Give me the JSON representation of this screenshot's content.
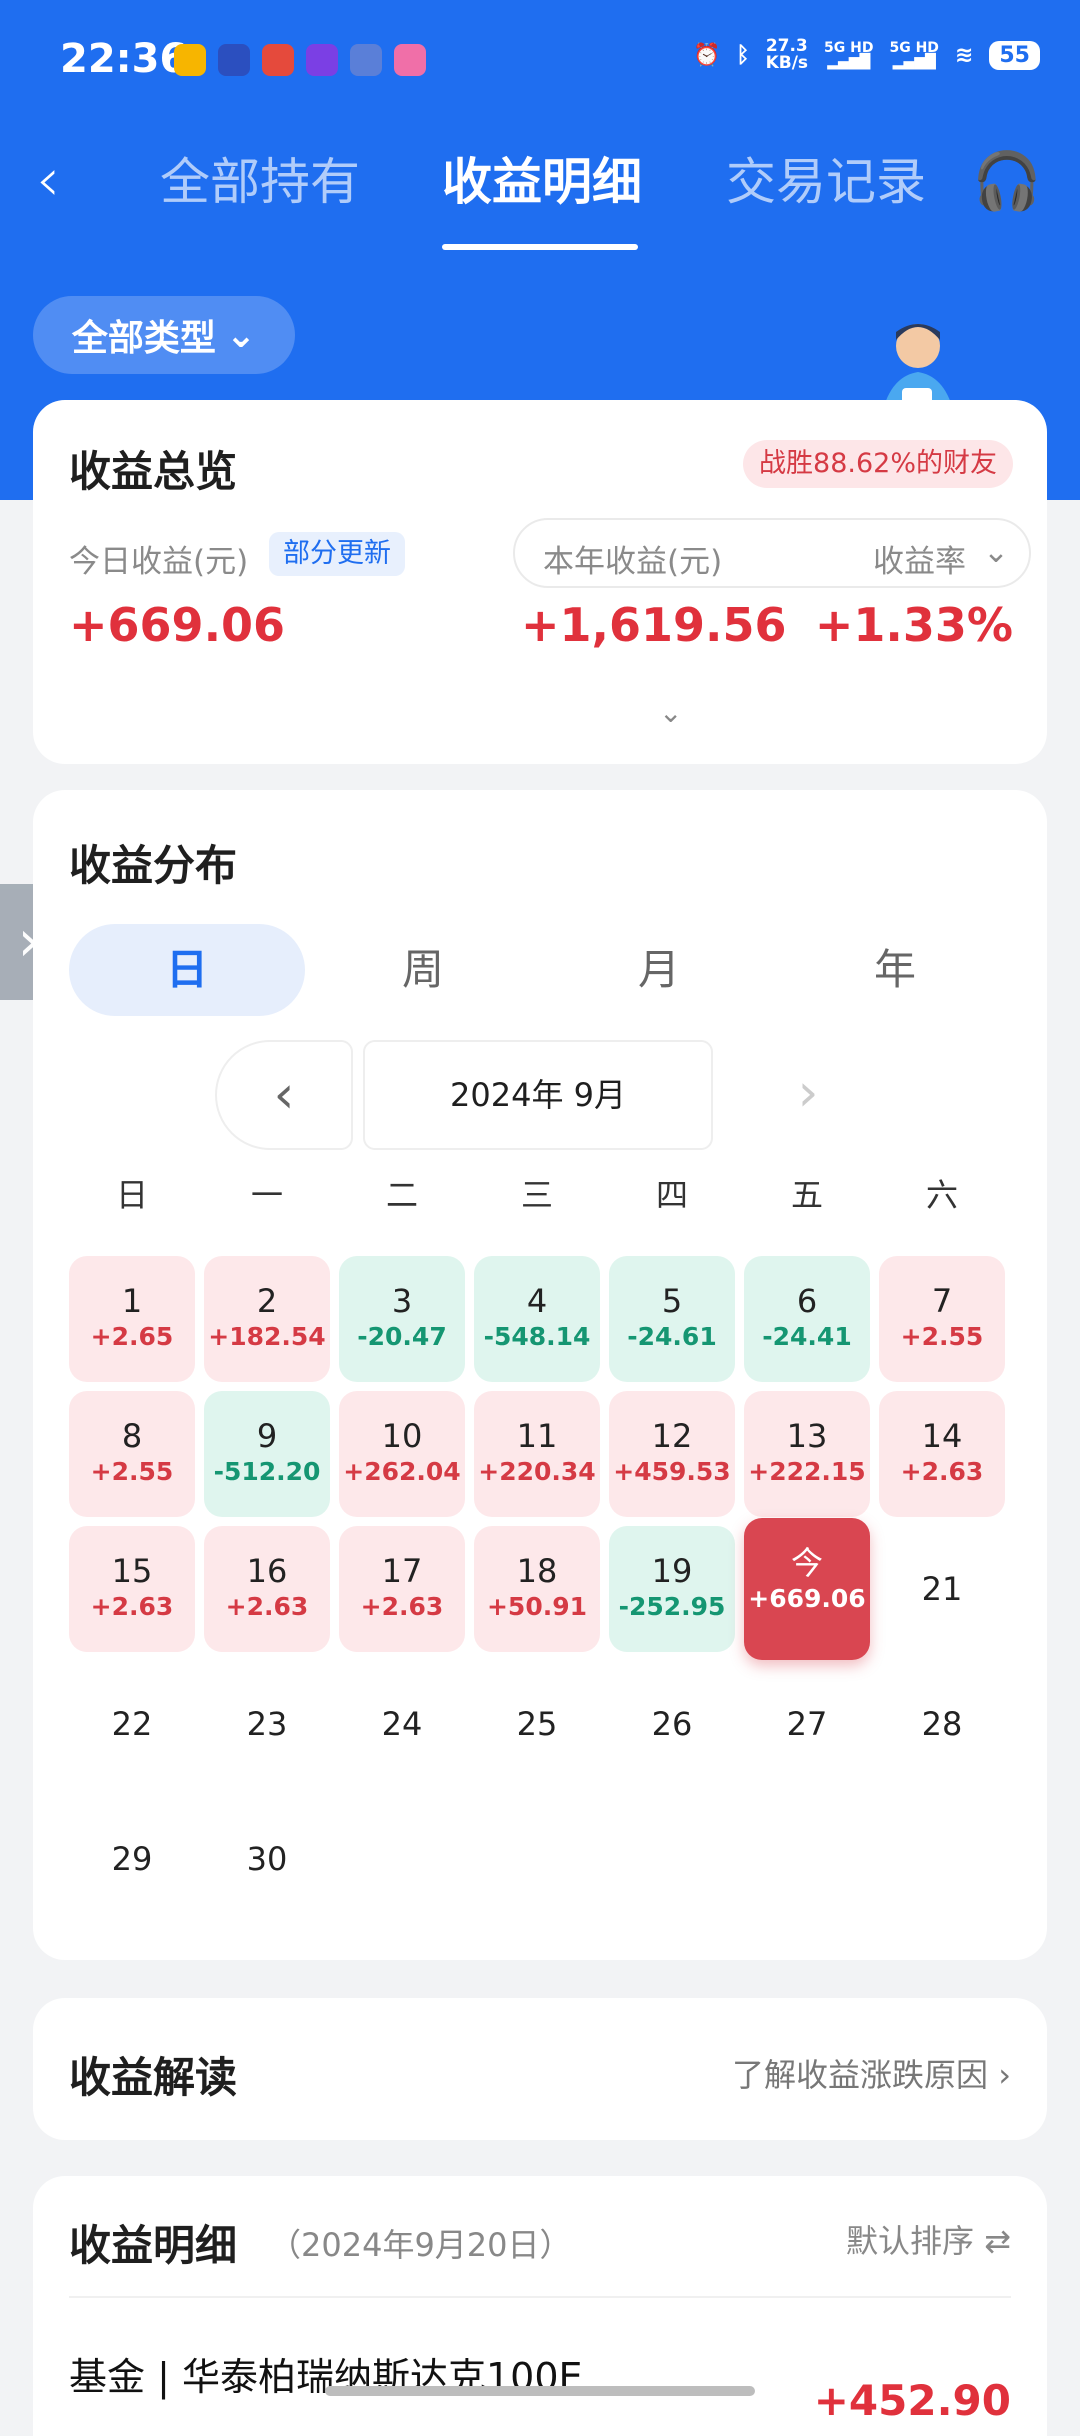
{
  "status": {
    "time": "22:36",
    "speed_value": "27.3",
    "speed_unit": "KB/s",
    "sig1": "5G HD",
    "sig2": "5G HD",
    "battery": "55"
  },
  "nav": {
    "tabs": [
      {
        "label": "全部持有"
      },
      {
        "label": "收益明细"
      },
      {
        "label": "交易记录"
      }
    ],
    "active_tab": "收益明细",
    "back_icon": "chevron-left-icon",
    "support_icon": "headset-icon"
  },
  "filter": {
    "label": "全部类型"
  },
  "overview": {
    "title": "收益总览",
    "beat_text": "战胜88.62%的财友",
    "today_label": "今日收益(元)",
    "partial_tag": "部分更新",
    "year_label": "本年收益(元)",
    "rate_label": "收益率",
    "today_value": "+669.06",
    "year_value": "+1,619.56",
    "rate_value": "+1.33%"
  },
  "distribution": {
    "title": "收益分布",
    "segments": [
      {
        "label": "日"
      },
      {
        "label": "周"
      },
      {
        "label": "月"
      },
      {
        "label": "年"
      }
    ],
    "active_segment": "日",
    "month_label": "2024年 9月",
    "weekdays": [
      "日",
      "一",
      "二",
      "三",
      "四",
      "五",
      "六"
    ],
    "days": [
      {
        "day": "1",
        "value": "+2.65",
        "kind": "gain"
      },
      {
        "day": "2",
        "value": "+182.54",
        "kind": "gain"
      },
      {
        "day": "3",
        "value": "-20.47",
        "kind": "loss"
      },
      {
        "day": "4",
        "value": "-548.14",
        "kind": "loss"
      },
      {
        "day": "5",
        "value": "-24.61",
        "kind": "loss"
      },
      {
        "day": "6",
        "value": "-24.41",
        "kind": "loss"
      },
      {
        "day": "7",
        "value": "+2.55",
        "kind": "gain"
      },
      {
        "day": "8",
        "value": "+2.55",
        "kind": "gain"
      },
      {
        "day": "9",
        "value": "-512.20",
        "kind": "loss"
      },
      {
        "day": "10",
        "value": "+262.04",
        "kind": "gain"
      },
      {
        "day": "11",
        "value": "+220.34",
        "kind": "gain"
      },
      {
        "day": "12",
        "value": "+459.53",
        "kind": "gain"
      },
      {
        "day": "13",
        "value": "+222.15",
        "kind": "gain"
      },
      {
        "day": "14",
        "value": "+2.63",
        "kind": "gain"
      },
      {
        "day": "15",
        "value": "+2.63",
        "kind": "gain"
      },
      {
        "day": "16",
        "value": "+2.63",
        "kind": "gain"
      },
      {
        "day": "17",
        "value": "+2.63",
        "kind": "gain"
      },
      {
        "day": "18",
        "value": "+50.91",
        "kind": "gain"
      },
      {
        "day": "19",
        "value": "-252.95",
        "kind": "loss"
      },
      {
        "day": "今",
        "value": "+669.06",
        "kind": "today"
      },
      {
        "day": "21",
        "value": "",
        "kind": "plain"
      },
      {
        "day": "22",
        "value": "",
        "kind": "plain"
      },
      {
        "day": "23",
        "value": "",
        "kind": "plain"
      },
      {
        "day": "24",
        "value": "",
        "kind": "plain"
      },
      {
        "day": "25",
        "value": "",
        "kind": "plain"
      },
      {
        "day": "26",
        "value": "",
        "kind": "plain"
      },
      {
        "day": "27",
        "value": "",
        "kind": "plain"
      },
      {
        "day": "28",
        "value": "",
        "kind": "plain"
      },
      {
        "day": "29",
        "value": "",
        "kind": "plain"
      },
      {
        "day": "30",
        "value": "",
        "kind": "plain"
      }
    ]
  },
  "interpretation": {
    "title": "收益解读",
    "link": "了解收益涨跌原因"
  },
  "detail": {
    "title": "收益明细",
    "date": "（2024年9月20日）",
    "sort": "默认排序",
    "fund_name": "基金 | 华泰柏瑞纳斯达克100E",
    "fund_value": "+452.90"
  },
  "colors": {
    "brand": "#1f6ef0",
    "gain": "#d53a44",
    "loss": "#159672"
  }
}
